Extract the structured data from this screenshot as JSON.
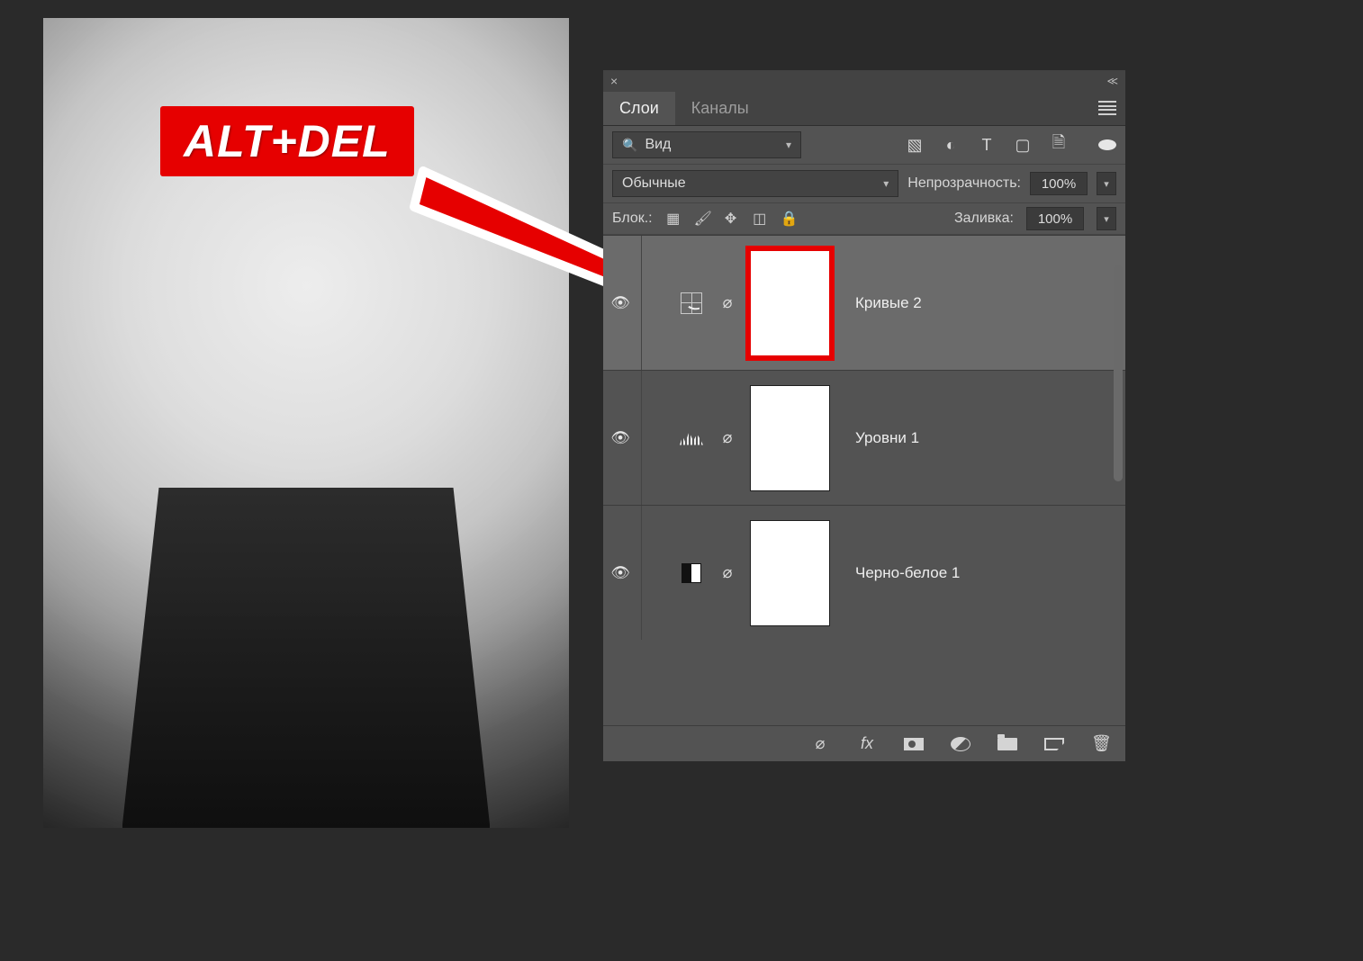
{
  "annotation": {
    "badge_text": "ALT+DEL"
  },
  "panel": {
    "tabs": {
      "active": "Слои",
      "other": "Каналы"
    },
    "filter": {
      "search_label": "Вид"
    },
    "blend": {
      "mode": "Обычные",
      "opacity_label": "Непрозрачность:",
      "opacity_value": "100%"
    },
    "fill": {
      "label": "Заливка:",
      "value": "100%"
    },
    "lock_row": {
      "label": "Блок.:"
    },
    "layers": [
      {
        "name": "Кривые 2",
        "type": "curves",
        "selected": true,
        "highlight_mask": true
      },
      {
        "name": "Уровни 1",
        "type": "levels",
        "selected": false,
        "highlight_mask": false
      },
      {
        "name": "Черно-белое 1",
        "type": "bw",
        "selected": false,
        "highlight_mask": false
      }
    ]
  }
}
